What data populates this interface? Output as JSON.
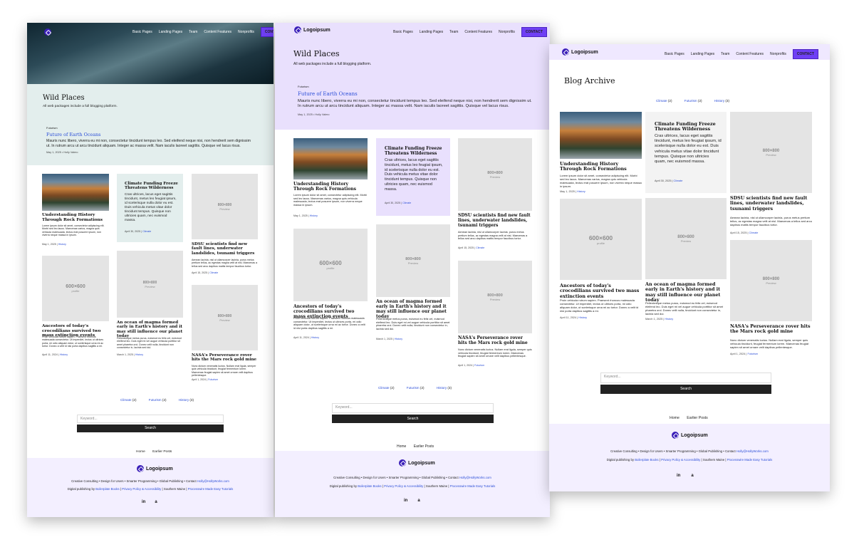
{
  "nav": {
    "logo": "Logoipsum",
    "items": [
      "Basic Pages",
      "Landing Pages",
      "Team",
      "Content Features",
      "Nonprofits"
    ],
    "cta": "CONTACT"
  },
  "site": {
    "title": "Wild Places",
    "tagline": "All web packages include a full blogging platform.",
    "archive_title": "Blog Archive"
  },
  "featured": {
    "kicker": "Futurism",
    "title": "Future of Earth Oceans",
    "excerpt": "Mauris nunc libero, viverra eu mi non, consectetur tincidunt tempus leo. Sed eleifend neque nisi, non hendrerit sem dignissim ut. In rutrum arcu ut arcu tincidunt aliquam. Integer ac massa velit. Nam iaculis laoreet sagittis. Quisque vel lacus risus.",
    "meta": "May 1, 2025 • Holly Valero"
  },
  "posts": {
    "history": {
      "title": "Understanding History Through Rock Formations",
      "excerpt": "Lorem ipsum dolor sit amet, consectetur adipiscing elit. Morbi sed leo lacus. Maecenas varius, magna quis vehicula malesuada, lectus erat posuere ipsum, non viverra neque massa in ipsum.",
      "date": "May 1, 2025",
      "cat": "History"
    },
    "climate": {
      "title": "Climate Funding Freeze Threatens Wilderness",
      "excerpt": "Cras ultrices, lacus eget sagittis tincidunt, metus leo feugiat ipsum, id scelerisque nulla dolor eu est. Duis vehicula metus vitae dolor tincidunt tempus. Quisque non ultricies quam, nec euismod massa.",
      "date": "April 30, 2025",
      "cat": "Climate"
    },
    "sdsu": {
      "title": "SDSU scientists find new fault lines, underwater landslides, tsunami triggers",
      "excerpt": "Aenean lacinia, nisl ut ullamcorper lacinia, purus metus pretium tellus, ac egestas magna velit at nisl. Maecenas a tellus sed arcu dapibus mattis tempor faucibus tortor.",
      "date": "April 15, 2025",
      "cat": "Climate"
    },
    "croc": {
      "title": "Ancestors of today's crocodilians survived two mass extinction events",
      "excerpt": "Proin vehicula rutrum sapien. Praesent rhoncus malesuada consectetur. Ut imperdiet, lectus ut ultrices porta, mi odio aliquam dolor, ut scelerisque urna mi ac tortor. Donec a velit id nisi porta dapibus sagittis a mi.",
      "date": "April 11, 2024",
      "cat": "History"
    },
    "magma": {
      "title": "An ocean of magma formed early in Earth's history and it may still influence our planet today",
      "excerpt": "Pellentesque metus purus, euismod eu felis vel, euismod eleifend leo. Duis eget mi vel augue vehicula porttitor sit amet pharetra orci. Donec velit nulla, tincidunt non consectetur in, lacinia sed dui.",
      "date": "March 1, 2025",
      "cat": "History"
    },
    "nasa": {
      "title": "NASA's Perseverance rover hits the Mars rock gold mine",
      "excerpt": "Nunc dictum venenatis luctus. Nullam erat ligula, semper quis vehicula tincidunt, feugiat fermentum lorem. Maecenas feugiat sapien sit amet ornare velit dapibus pellentesque.",
      "date": "April 1, 2024",
      "cat": "Futurism"
    }
  },
  "placeholders": {
    "sq_label": "600×600",
    "sq_sub": "profile",
    "rect_label": "800×800",
    "rect_sub": "Preview"
  },
  "categories": [
    {
      "name": "Climate",
      "count": "(2)"
    },
    {
      "name": "Futurism",
      "count": "(2)"
    },
    {
      "name": "History",
      "count": "(3)"
    }
  ],
  "search": {
    "placeholder": "Keyword...",
    "button": "Search"
  },
  "pagination": {
    "home": "Home",
    "earlier": "Earlier Posts"
  },
  "footer": {
    "logo": "Logoipsum",
    "services": "Creative Consulting • Design for Users • Smarter Programming • Global Publishing • Contact",
    "email": "Holly@HollyWorks.com",
    "credit_prefix": "Digital publishing by",
    "link1": "Boilerplate Books",
    "link2": "Privacy Policy & Accessibility",
    "location": "Southern Maine",
    "link3": "Processwire Made Easy Tutorials",
    "social1": "in",
    "social2": "a"
  },
  "colors": {
    "accent": "#6f3ff5",
    "panel1_band": "#e3eeed",
    "panel2_band": "#e9e0fd",
    "footer_bg": "#f3efff",
    "link": "#2c4fd8"
  }
}
